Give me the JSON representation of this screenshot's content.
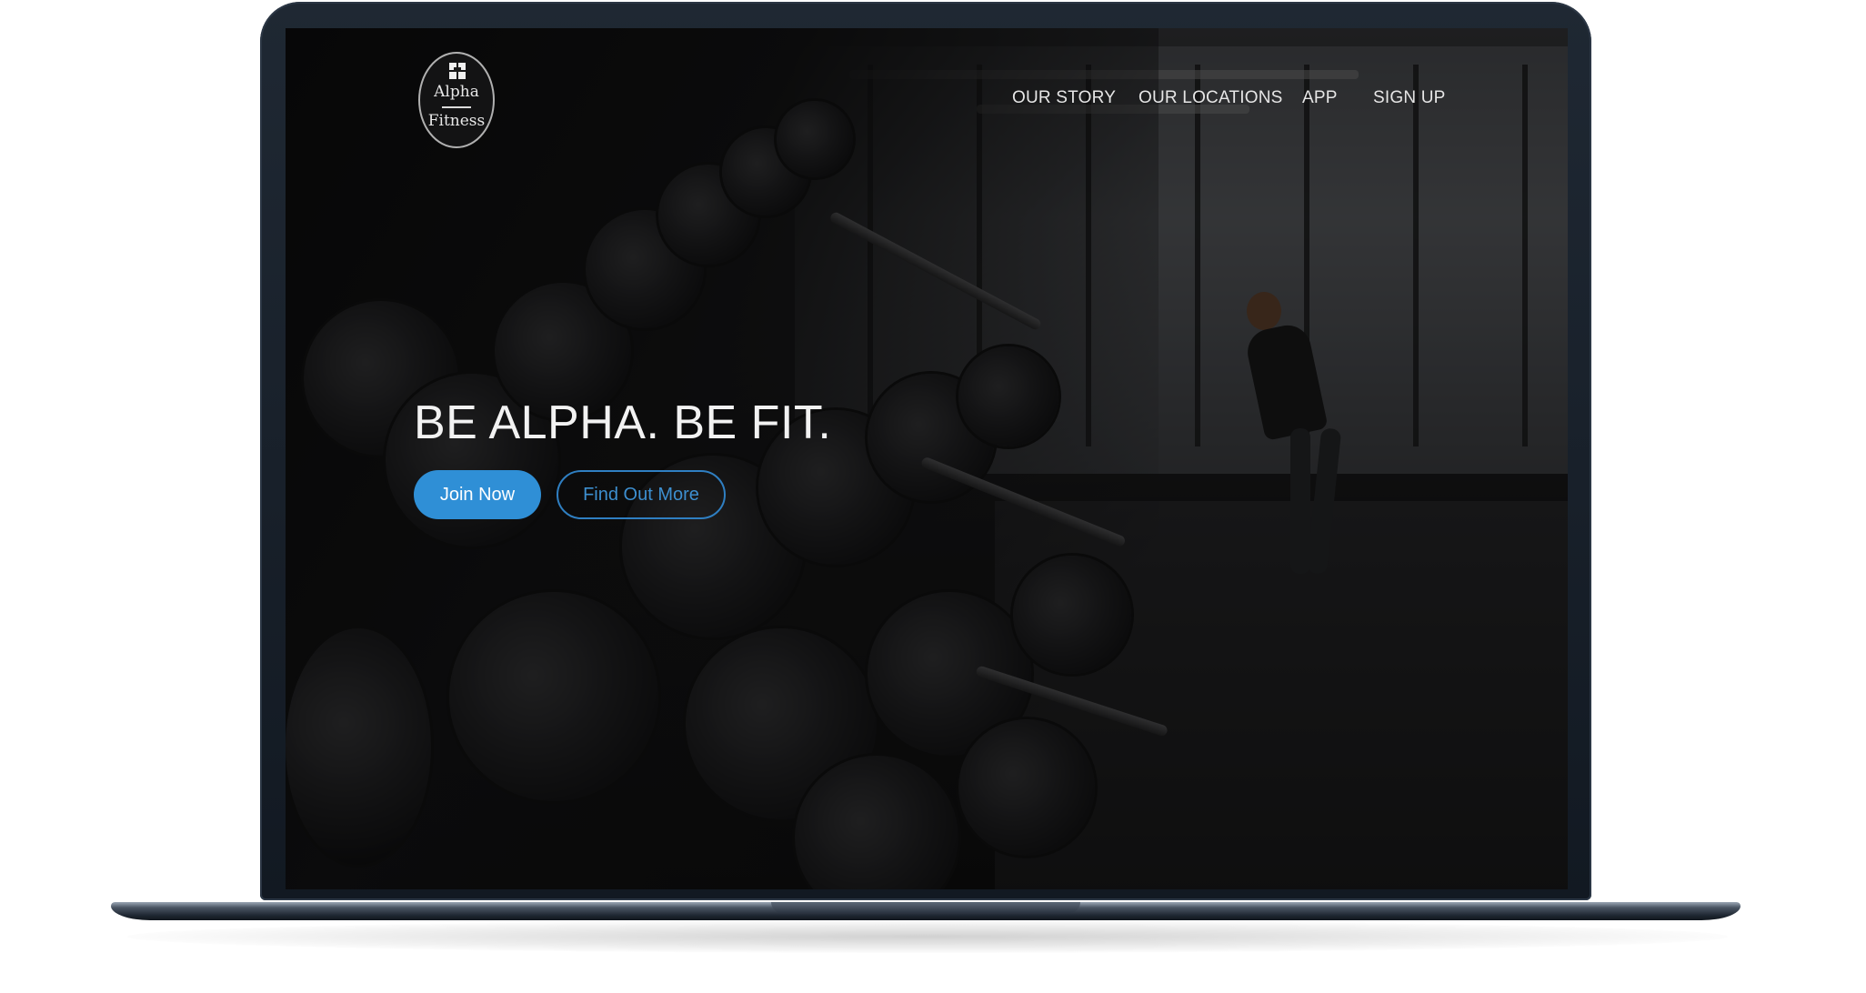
{
  "site": {
    "logo": {
      "line1": "Alpha",
      "line2": "Fitness"
    },
    "nav": [
      {
        "label": "OUR STORY"
      },
      {
        "label": "OUR LOCATIONS"
      },
      {
        "label": "APP"
      },
      {
        "label": "SIGN UP"
      }
    ],
    "hero": {
      "title": "BE ALPHA. BE FIT.",
      "primary_button": "Join Now",
      "secondary_button": "Find Out More"
    }
  },
  "colors": {
    "accent": "#2f8fd6",
    "outline_button": "#2f7fc2",
    "laptop_frame": "#1f2833",
    "nav_text": "#e6e6e6"
  },
  "icons": {
    "logo": "alpha-fitness-logo-icon"
  }
}
